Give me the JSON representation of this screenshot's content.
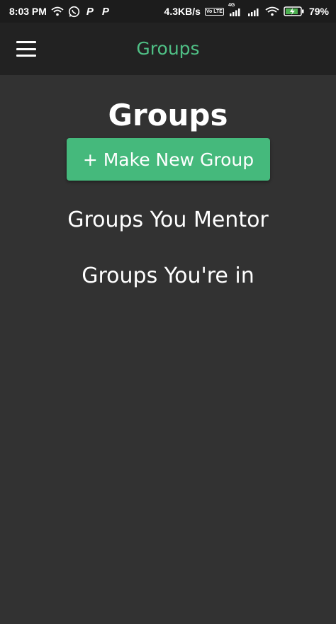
{
  "status_bar": {
    "time": "8:03 PM",
    "network_speed": "4.3KB/s",
    "network_type": "4G",
    "lte_label": "Vo LTE",
    "battery_percent": "79%",
    "icons": [
      "wifi-icon",
      "whatsapp-icon",
      "p-app-icon",
      "p-app-icon",
      "volte-icon",
      "signal-icon",
      "signal-icon",
      "wifi-icon",
      "battery-charging-icon"
    ]
  },
  "app_bar": {
    "title": "Groups",
    "menu_icon": "hamburger-menu-icon"
  },
  "main": {
    "title": "Groups",
    "make_group_button": "+ Make New Group",
    "mentor_heading": "Groups You Mentor",
    "member_heading": "Groups You're in"
  },
  "colors": {
    "accent": "#45b97c",
    "title_accent": "#4fbf85",
    "background": "#323232",
    "app_bar": "#222222",
    "status_bar": "#1c1c1c"
  }
}
